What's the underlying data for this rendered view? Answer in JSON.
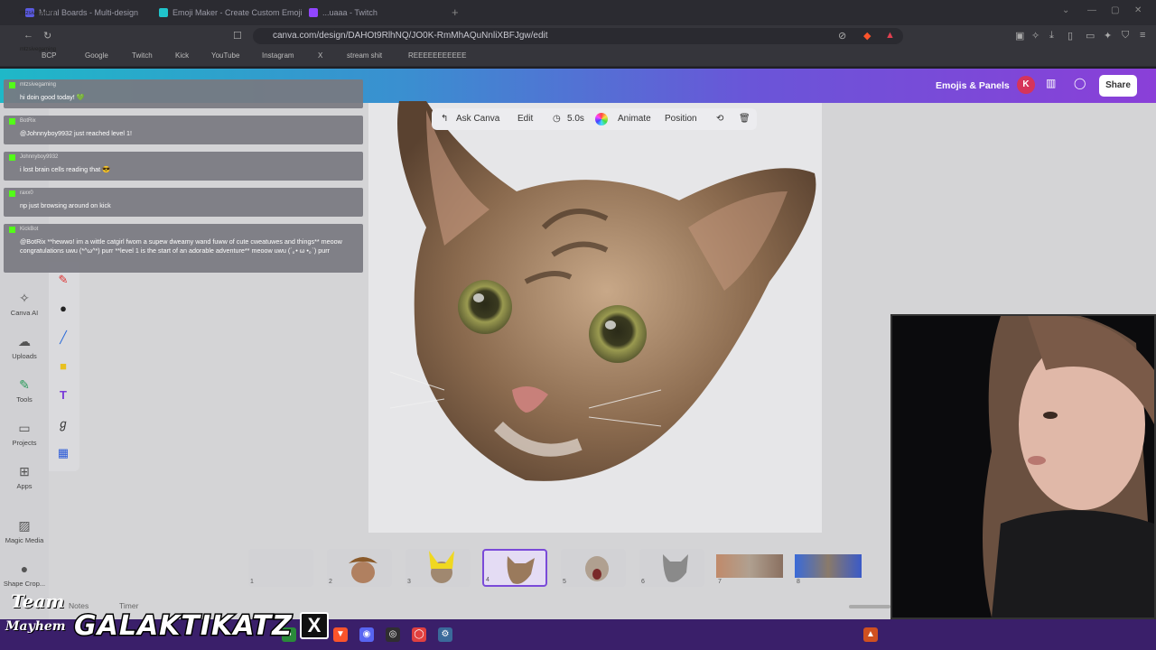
{
  "browser": {
    "tabs": [
      {
        "label": "Mural Boards - Multi-design"
      },
      {
        "label": "Emoji Maker - Create Custom Emoji"
      },
      {
        "label": "...uaaa - Twitch"
      }
    ],
    "url": "canva.com/design/DAHOt9RlhNQ/JO0K-RmMhAQuNnliXBFJgw/edit",
    "bookmarks": [
      "BCP",
      "Google",
      "Twitch",
      "Kick",
      "YouTube",
      "Instagram",
      "X",
      "stream shit",
      "REEEEEEEEEEE"
    ]
  },
  "header": {
    "title": "Emojis & Panels",
    "avatar_initial": "K",
    "share_label": "Share"
  },
  "sidebar": {
    "items": [
      {
        "label": "Canva AI",
        "icon": "canva-ai-icon"
      },
      {
        "label": "Uploads",
        "icon": "upload-icon"
      },
      {
        "label": "Tools",
        "icon": "tools-icon"
      },
      {
        "label": "Projects",
        "icon": "folder-icon"
      },
      {
        "label": "Apps",
        "icon": "apps-icon"
      },
      {
        "label": "Magic Media",
        "icon": "magic-media-icon"
      },
      {
        "label": "Shape Crop...",
        "icon": "shape-crop-icon"
      }
    ]
  },
  "floatbar": {
    "ask_canva": "Ask Canva",
    "edit": "Edit",
    "duration": "5.0s",
    "animate": "Animate",
    "position": "Position"
  },
  "filmstrip": {
    "pages": [
      "1",
      "2",
      "3",
      "4",
      "5",
      "6",
      "7",
      "8"
    ],
    "selected": "4"
  },
  "bottom": {
    "notes": "Notes",
    "timer": "Timer"
  },
  "chat": {
    "messages": [
      {
        "user": "mtzsivegaming",
        "text": "hi doin good today! 💚"
      },
      {
        "user": "BotRix",
        "text": "@Johnnyboy9932 just reached level 1!"
      },
      {
        "user": "Johnnyboy9932",
        "text": "i lost brain cells reading that 😎"
      },
      {
        "user": "raxx0",
        "text": "np just browsing around on kick"
      },
      {
        "user": "KickBot",
        "text": "@BotRix **hewwo! im a wittle catgirl fwom a supew dweamy wand fuww of cute cweatuwes and things** meoow congratulations uwu (*^ω^*) purr **level 1 is the start of an adorable adventure** meoow uwu (´｡• ω •｡`) purr"
      }
    ],
    "ghost_users": [
      "mtzsivegaming",
      "mtzsivegaming"
    ]
  },
  "overlay": {
    "team": "Team",
    "mayhem": "Mayhem",
    "brand": "GALAKTIKATZ",
    "x_logo": "X"
  },
  "colors": {
    "kick_green": "#53fc18",
    "header_gradient_start": "#1fb8c8",
    "header_gradient_end": "#8a3fd8",
    "selected_frame": "#7a4ad8"
  }
}
